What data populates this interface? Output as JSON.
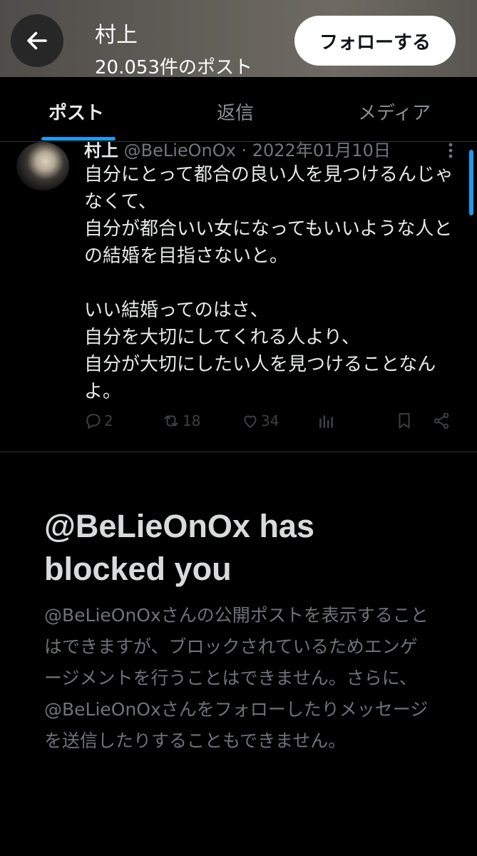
{
  "header": {
    "title": "村上",
    "post_count": "20.053件のポスト",
    "follow_label": "フォローする",
    "back_icon": "arrow-left-icon"
  },
  "tabs": [
    {
      "label": "ポスト",
      "active": true
    },
    {
      "label": "返信",
      "active": false
    },
    {
      "label": "メディア",
      "active": false
    }
  ],
  "post": {
    "author": "村上",
    "handle_date": " @BeLieOnOx · 2022年01月10日",
    "body": "自分にとって都合の良い人を見つけるんじゃなくて、\n自分が都合いい女になってもいいような人との結婚を目指さないと。\n\nいい結婚ってのはさ、\n自分を大切にしてくれる人より、\n自分が大切にしたい人を見つけることなんよ。",
    "replies": "2",
    "reposts": "18",
    "likes": "34"
  },
  "blocked": {
    "title": "@BeLieOnOx has blocked you",
    "description": "@BeLieOnOxさんの公開ポストを表示することはできますが、ブロックされているためエンゲージメントを行うことはできません。さらに、@BeLieOnOxさんをフォローしたりメッセージを送信したりすることもできません。"
  },
  "colors": {
    "accent": "#1d9bf0",
    "background": "#000000",
    "text": "#e7e9ea",
    "muted": "#71767b"
  }
}
